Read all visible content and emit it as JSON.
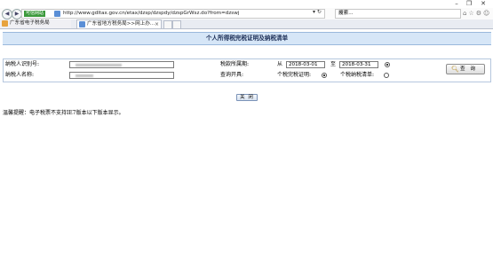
{
  "window": {
    "minimize_glyph": "–",
    "maximize_glyph": "❐",
    "close_glyph": "✕"
  },
  "toolbar": {
    "back_glyph": "◀",
    "forward_glyph": "▶",
    "security_badge": "可信网站",
    "url": "http://www.gdltax.gov.cn/etax/dzsp/dzspdy/dzspGrWsz.do?from=dzswj",
    "addr_tools": "▾ ↻",
    "search_placeholder": "搜索...",
    "search_icon": "search-icon",
    "right_icons": "⌂☆⚙☺"
  },
  "tabs": {
    "favorites_label": "广东省电子税务局",
    "active_tab_label": "广东省地方税务局>>网上办...",
    "close_glyph": "×"
  },
  "page": {
    "title": "个人所得税完税证明及纳税清单",
    "form": {
      "taxpayer_id_label": "纳税人识别号:",
      "taxpayer_name_label": "纳税人名称:",
      "period_label": "税款所属期:",
      "from_label": "从",
      "from_date": "2018-03-01",
      "to_label": "至",
      "to_date": "2018-03-31",
      "open_label": "查询开具:",
      "option_certificate": "个税完税证明:",
      "option_list": "个税纳税清单:",
      "selected_option": "certificate",
      "query_button": "查 询",
      "query_icon": "magnifier-icon"
    },
    "close_button": "关 闭",
    "notice": "温馨提醒：电子税票不支持IE7版本以下版本显示。"
  }
}
